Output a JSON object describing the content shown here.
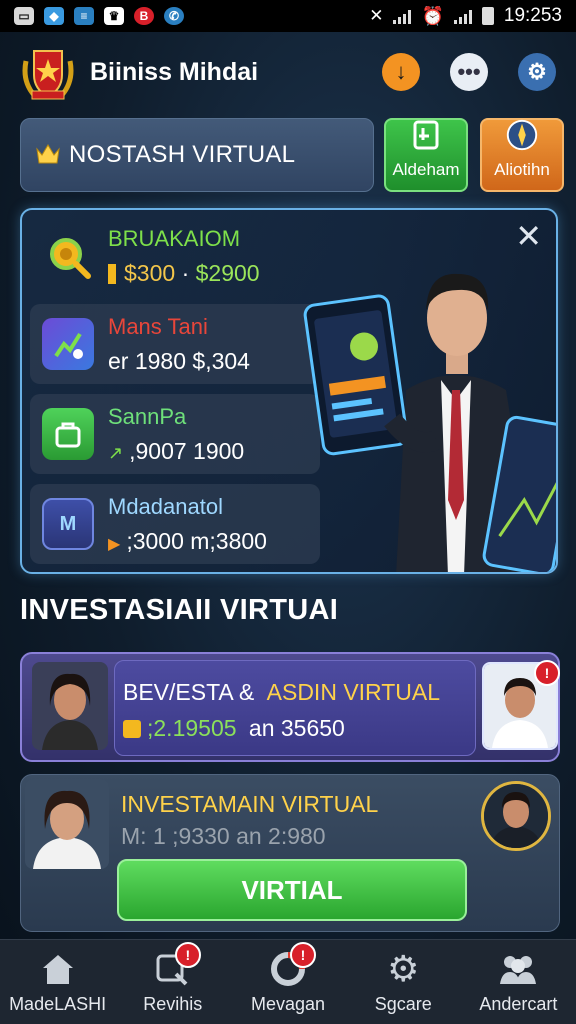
{
  "status_bar": {
    "time": "19:253"
  },
  "app": {
    "title": "Biiniss Mihdai"
  },
  "banner": {
    "title": "NOSTASH VIRTUAL"
  },
  "action_tiles": [
    {
      "label": "Aldeham"
    },
    {
      "label": "Aliotihn"
    }
  ],
  "panel": {
    "rows": [
      {
        "name": "BRUAKAIOM",
        "value_a": "$300",
        "separator": "·",
        "value_b": "$2900",
        "name_color": "#7ee04a"
      },
      {
        "name": "Mans Tani",
        "value": "er 1980 $,304",
        "name_color": "#e8463a"
      },
      {
        "name": "SannPa",
        "value": ",9007 1900",
        "name_color": "#6ee07a"
      },
      {
        "name": "Mdadanatol",
        "value": ";3000 m;3800",
        "name_color": "#9fd8ff"
      }
    ]
  },
  "section": {
    "title": "INVESTASIAII VIRTUAI"
  },
  "card1": {
    "title_a": "BEV/ESTA &",
    "title_b": "ASDIN VIRTUAL",
    "value_a": ";2.19505",
    "value_b": "an 35650",
    "badge": "!"
  },
  "card2": {
    "title": "INVESTAMAIN VIRTUAL",
    "value": "M: 1 ;9330 an 2:980",
    "cta_label": "VIRTIAL"
  },
  "bottom_nav": [
    {
      "label": "MadeLASHI",
      "icon": "home-icon"
    },
    {
      "label": "Revihis",
      "icon": "search-icon",
      "badge": "!"
    },
    {
      "label": "Mevagan",
      "icon": "ring-icon",
      "badge": "!"
    },
    {
      "label": "Sgcare",
      "icon": "gear-icon"
    },
    {
      "label": "Andercart",
      "icon": "users-icon"
    }
  ],
  "colors": {
    "accent_gold": "#ffd24a",
    "accent_green": "#35b83c",
    "accent_orange": "#f39322",
    "panel_border": "#6ab1e6"
  }
}
